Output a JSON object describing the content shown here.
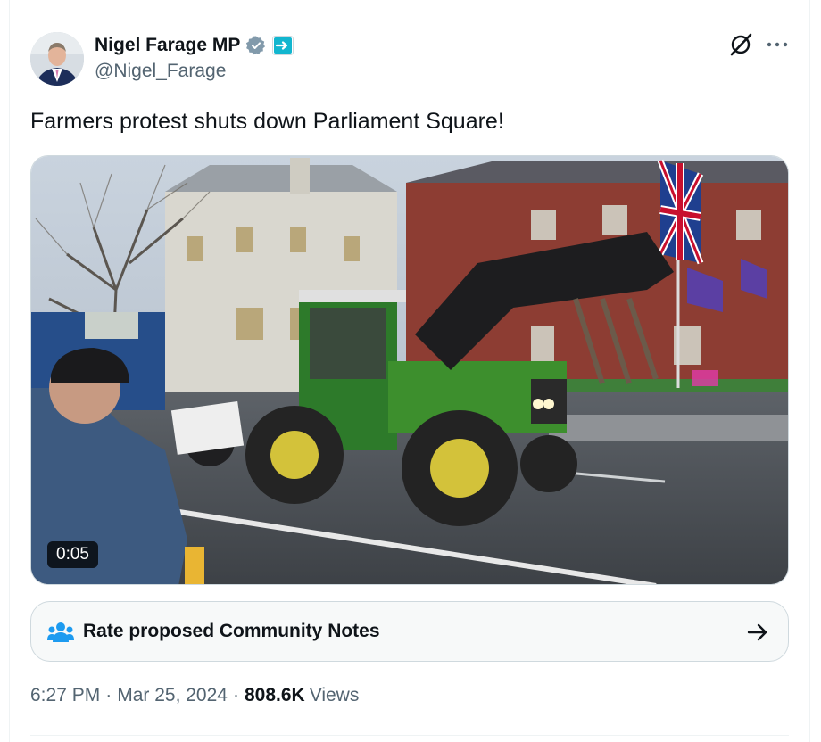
{
  "author": {
    "display_name": "Nigel Farage MP",
    "handle": "@Nigel_Farage",
    "verified_color": "#829aab",
    "affiliation_color": "#12b6cf"
  },
  "tweet": {
    "text": "Farmers protest shuts down Parliament Square!"
  },
  "media": {
    "type": "video",
    "timecode": "0:05"
  },
  "community_notes": {
    "label": "Rate proposed Community Notes",
    "icon": "people-icon",
    "accent": "#1d9bf0"
  },
  "meta": {
    "time": "6:27 PM",
    "separator": "·",
    "date": "Mar 25, 2024",
    "views_count": "808.6K",
    "views_label": "Views"
  },
  "icons": {
    "grok": "grok-icon",
    "more": "more-icon",
    "arrow": "arrow-right-icon"
  }
}
